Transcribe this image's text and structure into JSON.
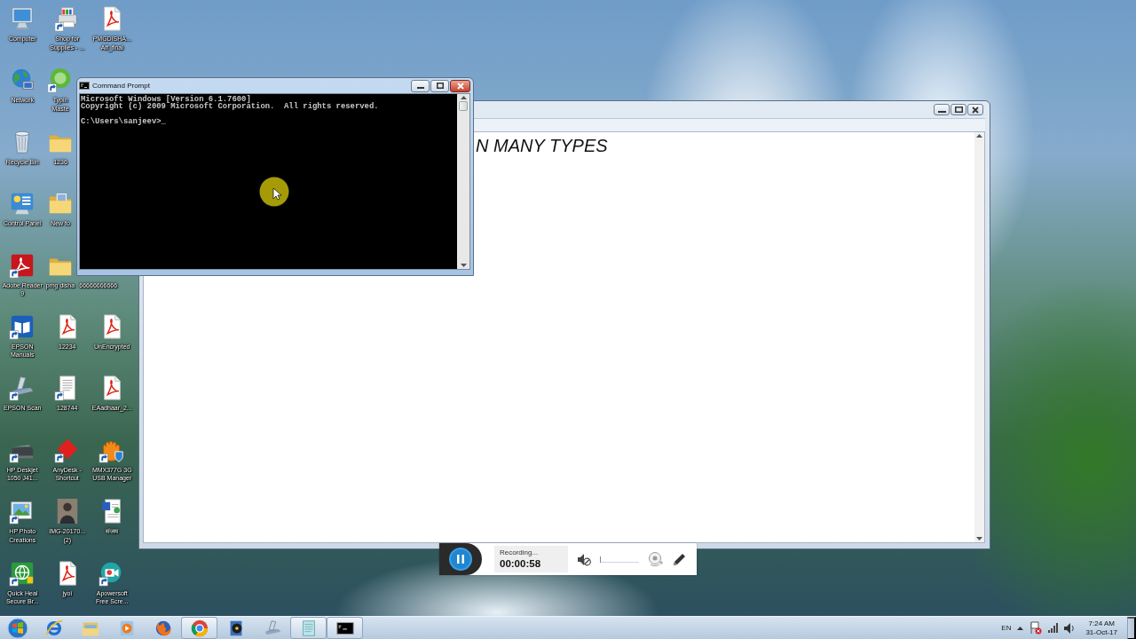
{
  "desktop": {
    "icon_rows": [
      [
        "Computer",
        "Shop for Supplies - ...",
        "PMGDISHA... Aff_final"
      ],
      [
        "Network",
        "Typin Maste"
      ],
      [
        "Recycle Bin",
        "1236"
      ],
      [
        "Control Panel",
        "New fo"
      ],
      [
        "Adobe Reader 9",
        "pmg disha",
        "66666666666"
      ],
      [
        "EPSON Manuals",
        "12234",
        "UnEncrypted"
      ],
      [
        "EPSON Scan",
        "128744",
        "EAadhaar_2..."
      ],
      [
        "HP Deskjet 1050 J41...",
        "AnyDesk - Shortcut",
        "MMX377G 3G USB Manager"
      ],
      [
        "HP Photo Creations",
        "IMG-20170... (2)",
        "संजय"
      ],
      [
        "Quick Heal Secure Br...",
        "jyoi",
        "Apowersoft Free Scre..."
      ]
    ]
  },
  "document_window": {
    "active": false,
    "text": "N MANY TYPES"
  },
  "command_window": {
    "active": true,
    "title": "Command Prompt",
    "lines": [
      "Microsoft Windows [Version 6.1.7600]",
      "Copyright (c) 2009 Microsoft Corporation.  All rights reserved."
    ],
    "prompt": "C:\\Users\\sanjeev>_"
  },
  "recorder": {
    "status": "Recording...",
    "elapsed": "00:00:58",
    "muted": true,
    "volume": {
      "level": 0
    }
  },
  "taskbar": {
    "buttons": [
      {
        "open": false
      },
      {
        "open": false
      },
      {
        "open": false
      },
      {
        "open": false
      },
      {
        "open": true
      },
      {
        "open": false
      },
      {
        "open": false
      },
      {
        "open": true
      },
      {
        "open": true
      }
    ],
    "tray": {
      "language": "EN",
      "time": "7:24 AM",
      "date": "31-Oct-17"
    }
  }
}
